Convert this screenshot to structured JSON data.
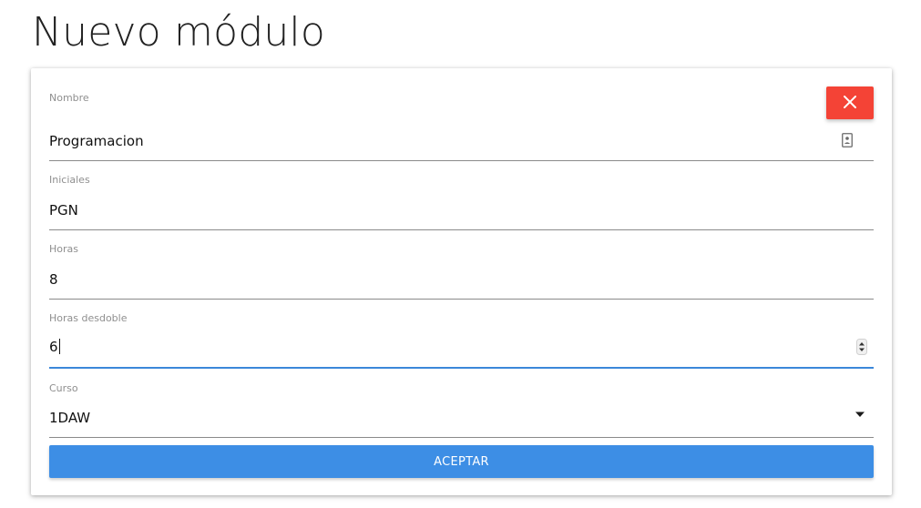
{
  "header": {
    "title": "Nuevo módulo"
  },
  "form": {
    "close_icon": "close-icon",
    "fields": [
      {
        "label": "Nombre",
        "value": "Programacion",
        "icon": "contact-card-icon"
      },
      {
        "label": "Iniciales",
        "value": "PGN"
      },
      {
        "label": "Horas",
        "value": "8"
      },
      {
        "label": "Horas desdoble",
        "value": "6",
        "icon": "spinner-arrows-icon"
      },
      {
        "label": "Curso",
        "value": "1DAW",
        "icon": "dropdown-arrow-icon"
      }
    ],
    "accept_label": "ACEPTAR"
  },
  "colors": {
    "close_button": "#f44336",
    "accept_button": "#3d8ee5",
    "active_underline": "#3b87d9"
  }
}
